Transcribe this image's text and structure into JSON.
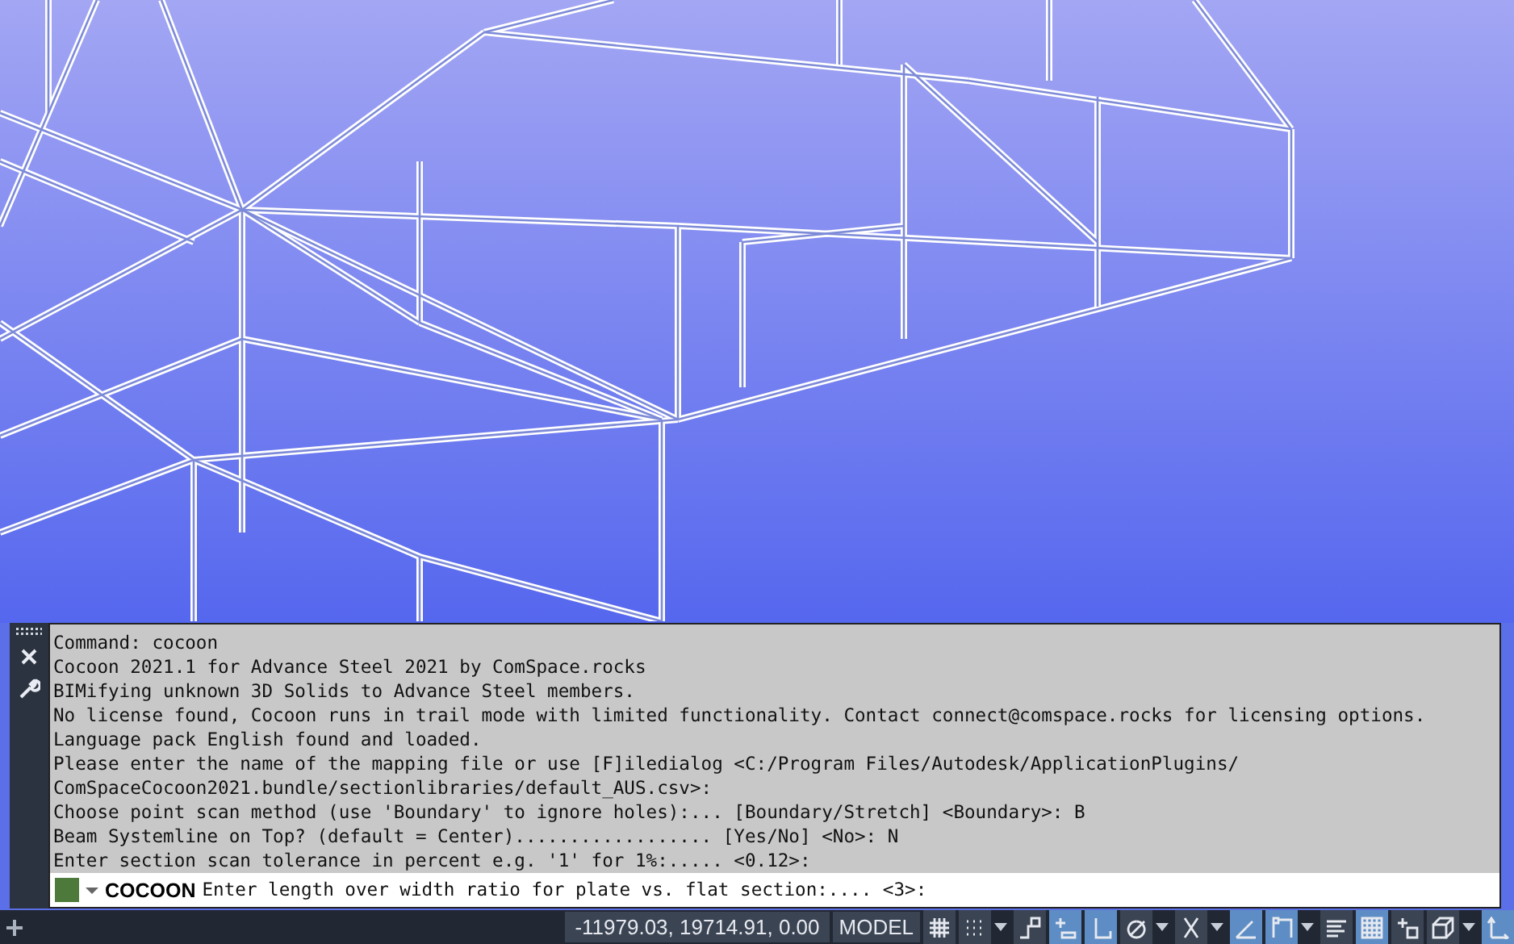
{
  "command_window": {
    "history": [
      "Command: cocoon",
      "Cocoon 2021.1 for Advance Steel 2021 by ComSpace.rocks",
      "BIMifying unknown 3D Solids to Advance Steel members.",
      "No license found, Cocoon runs in trail mode with limited functionality. Contact connect@comspace.rocks for licensing options.",
      "Language pack English found and loaded.",
      "Please enter the name of the mapping file or use [F]iledialog <C:/Program Files/Autodesk/ApplicationPlugins/",
      "ComSpaceCocoon2021.bundle/sectionlibraries/default_AUS.csv>:",
      "Choose point scan method (use 'Boundary' to ignore holes):... [Boundary/Stretch] <Boundary>: B",
      "Beam Systemline on Top? (default = Center).................. [Yes/No] <No>: N",
      "Enter section scan tolerance in percent e.g. '1' for 1%:..... <0.12>:"
    ],
    "prompt_command": "COCOON",
    "prompt": "Enter length over width ratio for plate vs. flat section:.... <3>:"
  },
  "status_bar": {
    "coordinates": "-11979.03, 19714.91, 0.00",
    "space": "MODEL",
    "tools": [
      {
        "kind": "grid",
        "on": false
      },
      {
        "kind": "snap",
        "on": false
      },
      {
        "kind": "caret"
      },
      {
        "kind": "infer",
        "on": false
      },
      {
        "kind": "dynamic-input",
        "on": true
      },
      {
        "kind": "ortho",
        "on": true
      },
      {
        "kind": "polar",
        "on": false
      },
      {
        "kind": "caret"
      },
      {
        "kind": "isodraft",
        "on": false
      },
      {
        "kind": "caret"
      },
      {
        "kind": "dynamic-ucs",
        "on": true
      },
      {
        "kind": "osnap",
        "on": true
      },
      {
        "kind": "caret"
      },
      {
        "kind": "lineweight",
        "on": false
      },
      {
        "kind": "transparency",
        "on": true
      },
      {
        "kind": "selection",
        "on": false
      },
      {
        "kind": "object-3d",
        "on": false
      },
      {
        "kind": "caret"
      },
      {
        "kind": "ucs",
        "on": true
      }
    ]
  }
}
